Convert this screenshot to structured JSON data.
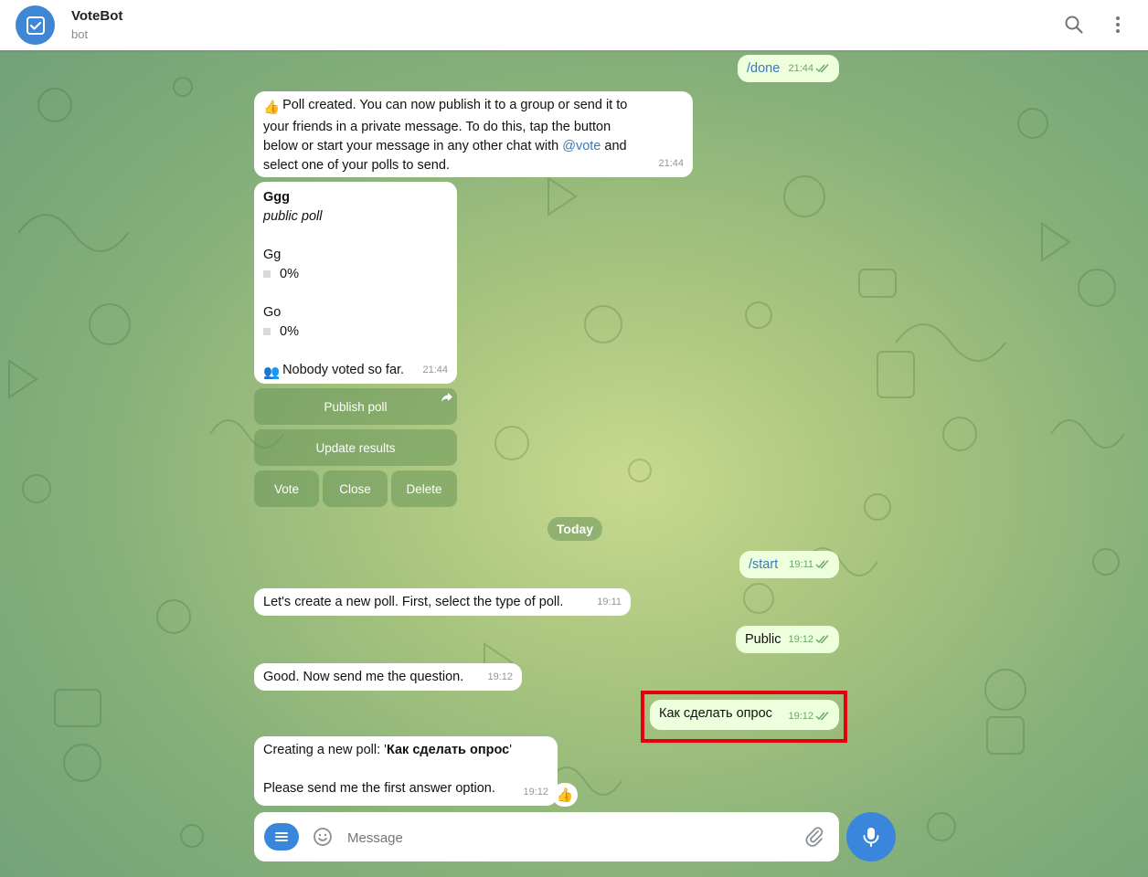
{
  "header": {
    "title": "VoteBot",
    "subtitle": "bot"
  },
  "messages": {
    "done": {
      "text": "/done",
      "time": "21:44"
    },
    "poll_created": {
      "line1": "Poll created. You can now publish it to a group or send it to",
      "line2": "your friends in a private message. To do this, tap the button",
      "line3_pre": "below or start your message in any other chat with ",
      "line3_link": "@vote",
      "line3_post": " and",
      "line4": "select one of your polls to send.",
      "time": "21:44"
    },
    "poll_card": {
      "title": "Ggg",
      "kind": "public poll",
      "option1": "Gg",
      "option1_pct": "0%",
      "option2": "Go",
      "option2_pct": "0%",
      "footer": "Nobody voted so far.",
      "time": "21:44"
    },
    "start": {
      "text": "/start",
      "time": "19:11"
    },
    "select_type": {
      "text": "Let's create a new poll. First, select the type of poll.",
      "time": "19:11"
    },
    "public": {
      "text": "Public",
      "time": "19:12"
    },
    "send_question": {
      "text": "Good. Now send me the question.",
      "time": "19:12"
    },
    "question": {
      "text": "Как сделать опрос",
      "time": "19:12"
    },
    "creating": {
      "line1_pre": "Creating a new poll: '",
      "line1_bold": "Как сделать опрос",
      "line1_post": "'",
      "line2": "Please send me the first answer option.",
      "time": "19:12"
    }
  },
  "keyboard": {
    "publish": "Publish poll",
    "update": "Update results",
    "vote": "Vote",
    "close": "Close",
    "delete": "Delete"
  },
  "date_divider": "Today",
  "composer": {
    "placeholder": "Message"
  },
  "colors": {
    "accent": "#3b86dd",
    "outgoing_bubble": "#eeffde",
    "highlight": "#e4000f"
  },
  "icons": [
    "search-icon",
    "more-vert-icon",
    "menu-icon",
    "emoji-icon",
    "attach-icon",
    "mic-icon",
    "share-icon",
    "read-ticks-icon"
  ]
}
